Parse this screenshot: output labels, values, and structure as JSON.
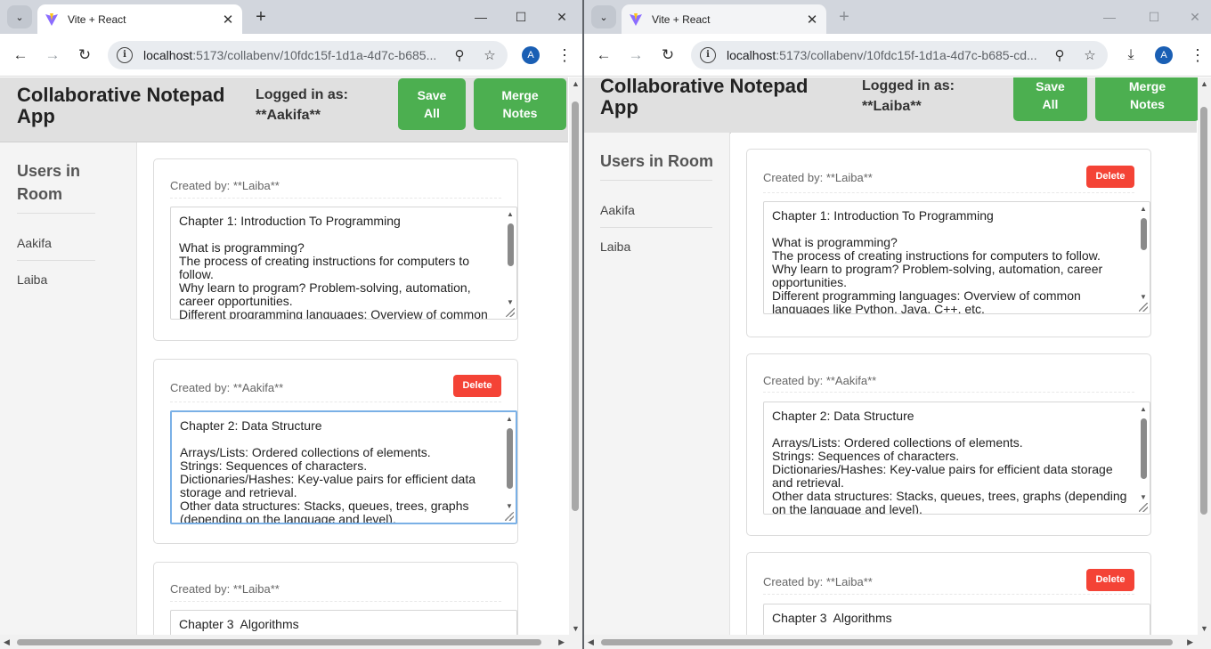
{
  "browser": {
    "tab_title": "Vite + React",
    "close_symbol": "✕",
    "new_tab_symbol": "+",
    "tab_search_symbol": "⌄",
    "minimize_symbol": "—",
    "maximize_symbol": "☐",
    "window_close_symbol": "✕",
    "back_symbol": "←",
    "forward_symbol": "→",
    "reload_symbol": "↻",
    "info_symbol": "i",
    "zoom_symbol": "⚲",
    "star_symbol": "☆",
    "download_symbol": "⤓",
    "menu_symbol": "⋮",
    "avatar_letter": "A"
  },
  "left_window": {
    "url_host": "localhost",
    "url_rest": ":5173/collabenv/10fdc15f-1d1a-4d7c-b685..."
  },
  "right_window": {
    "url_host": "localhost",
    "url_rest": ":5173/collabenv/10fdc15f-1d1a-4d7c-b685-cd..."
  },
  "app": {
    "title_line1": "Collaborative Notepad",
    "title_line2": "App",
    "logged_label": "Logged in as:",
    "save_line1": "Save",
    "save_line2": "All",
    "merge_line1": "Merge",
    "merge_line2": "Notes",
    "users_title_line1": "Users in",
    "users_title_line2": "Room",
    "users_title_one_line": "Users in Room",
    "users": [
      "Aakifa",
      "Laiba"
    ],
    "delete_label": "Delete",
    "notes": [
      {
        "created_by": "Created by: **Laiba**",
        "text": "Chapter 1: Introduction To Programming\n\nWhat is programming?\nThe process of creating instructions for computers to follow.\nWhy learn to program? Problem-solving, automation, career opportunities.\nDifferent programming languages: Overview of common languages like Python, Java, C++, etc."
      },
      {
        "created_by": "Created by: **Aakifa**",
        "text": "Chapter 2: Data Structure\n\nArrays/Lists: Ordered collections of elements.\nStrings: Sequences of characters.\nDictionaries/Hashes: Key-value pairs for efficient data storage and retrieval.\nOther data structures: Stacks, queues, trees, graphs (depending on the language and level)."
      },
      {
        "created_by": "Created by: **Laiba**",
        "text": "Chapter 3  Algorithms"
      }
    ]
  },
  "left_user": "**Aakifa**",
  "right_user": "**Laiba**"
}
